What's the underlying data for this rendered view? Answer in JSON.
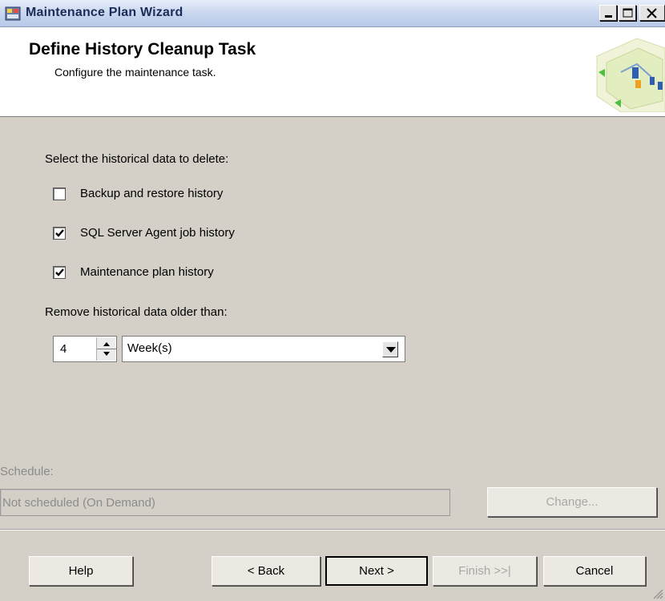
{
  "window": {
    "title": "Maintenance Plan Wizard"
  },
  "header": {
    "title": "Define History Cleanup Task",
    "subtitle": "Configure the maintenance task."
  },
  "history": {
    "label": "Select the historical data to delete:",
    "options": [
      {
        "label": "Backup and restore history",
        "checked": false
      },
      {
        "label": "SQL Server Agent job history",
        "checked": true
      },
      {
        "label": "Maintenance plan history",
        "checked": true
      }
    ]
  },
  "retention": {
    "label": "Remove historical data older than:",
    "value": "4",
    "unit": "Week(s)"
  },
  "schedule": {
    "label": "Schedule:",
    "value": "Not scheduled (On Demand)",
    "change_label": "Change..."
  },
  "buttons": {
    "help": "Help",
    "back": "< Back",
    "next": "Next >",
    "finish": "Finish >>|",
    "cancel": "Cancel"
  },
  "icons": {
    "app": "wizard-app-icon",
    "minimize": "minimize-icon",
    "maximize": "maximize-icon",
    "close": "close-icon",
    "header_graphic": "flowchart-graphic-icon",
    "checkmark": "checkmark-icon",
    "dropdown": "chevron-down-icon",
    "spin": "spin-arrows-icon"
  },
  "colors": {
    "dialog_bg": "#d4d0c8",
    "title_text": "#1c2c5a",
    "disabled_text": "#8c8c8c"
  }
}
